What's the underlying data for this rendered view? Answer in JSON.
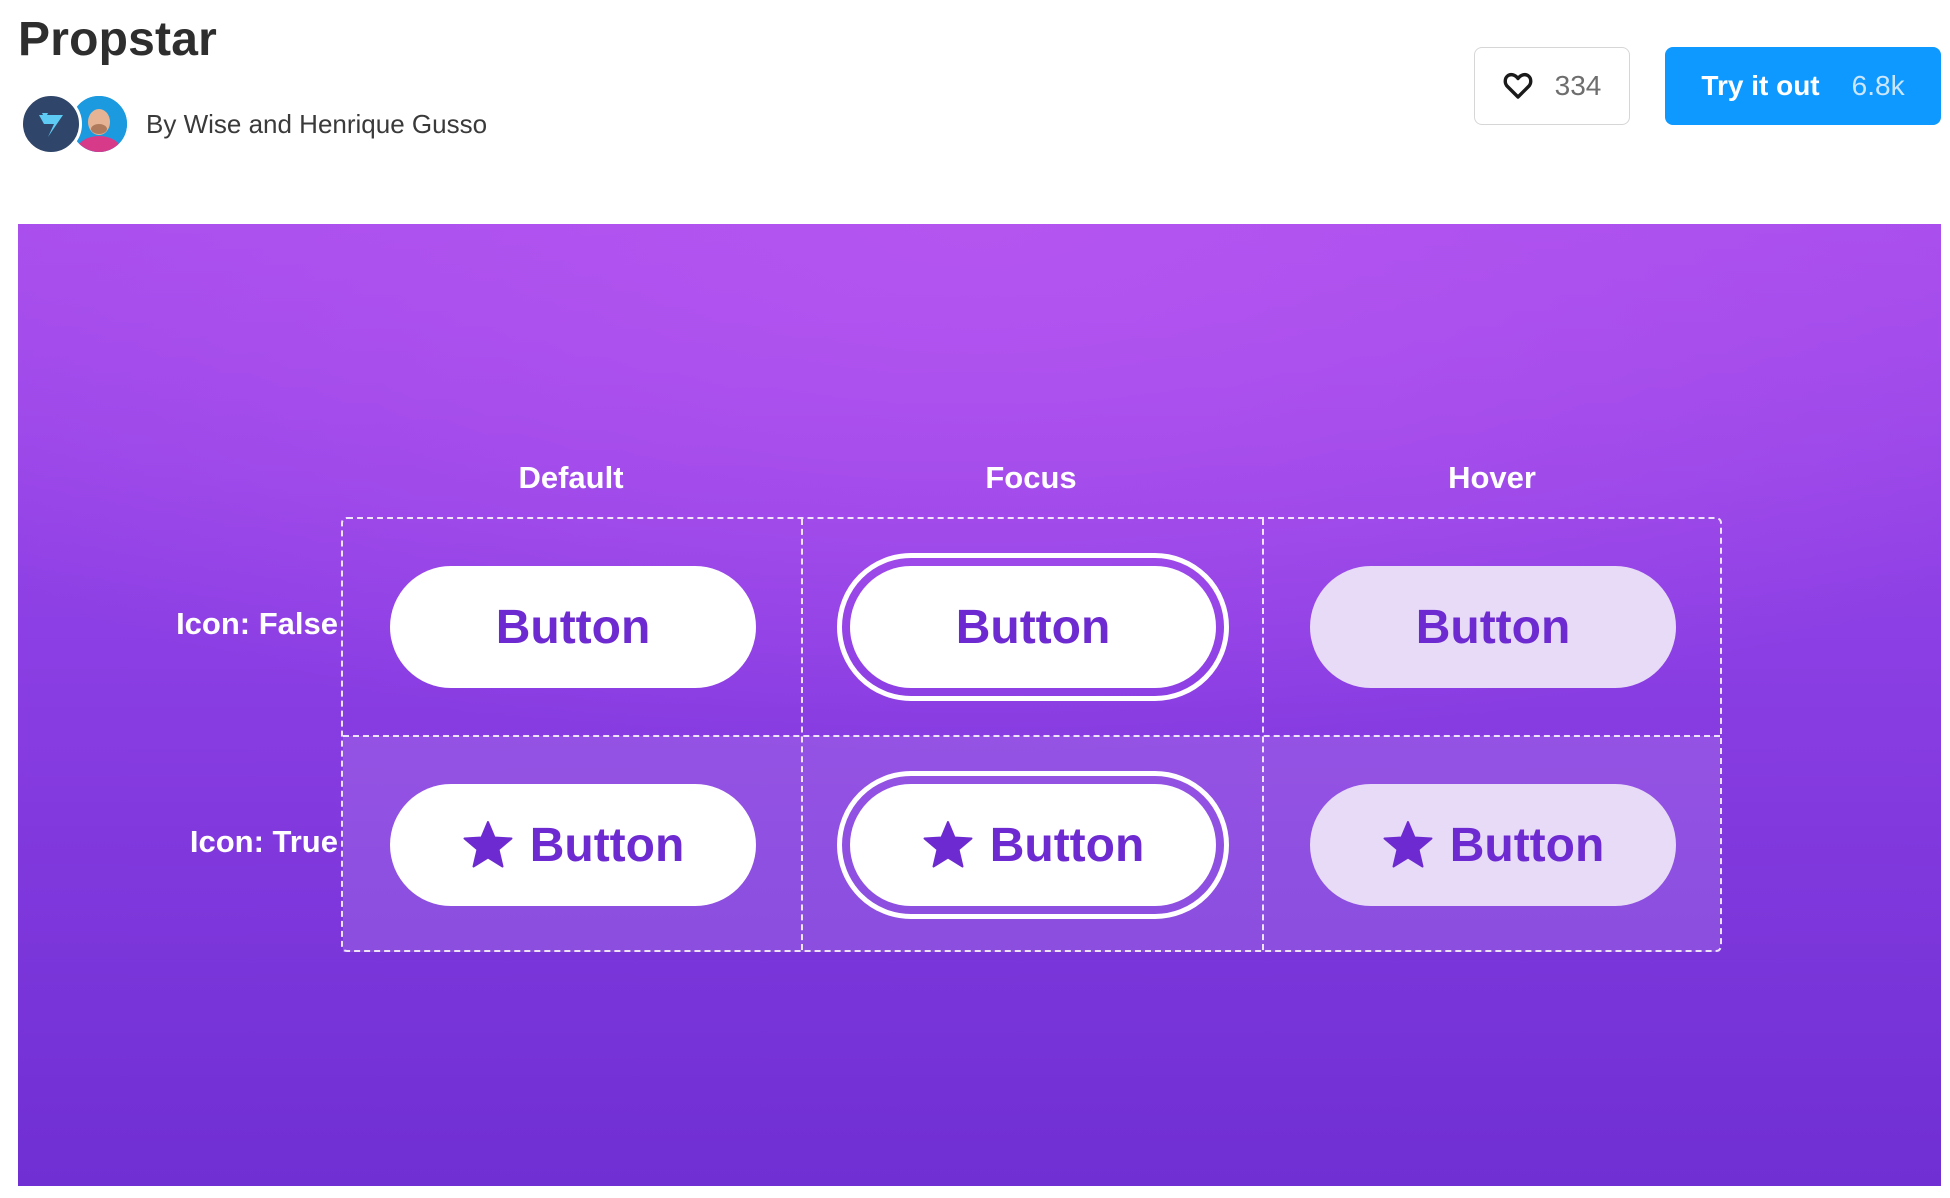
{
  "header": {
    "title": "Propstar",
    "byline": "By Wise and Henrique Gusso",
    "like_count": "334",
    "try_label": "Try it out",
    "try_count": "6.8k"
  },
  "preview": {
    "columns": [
      "Default",
      "Focus",
      "Hover"
    ],
    "rows": [
      "Icon: False",
      "Icon: True"
    ],
    "button_label": "Button",
    "colors": {
      "button_text": "#6e2ad1",
      "hover_fill": "#e8dbf7",
      "background_top": "#a64ded",
      "background_bottom": "#6f2fd3"
    }
  },
  "icons": {
    "like": "heart-icon",
    "button_icon": "star-icon",
    "wise_logo": "wise-logo-icon"
  },
  "colors": {
    "primary": "#0d99ff"
  }
}
